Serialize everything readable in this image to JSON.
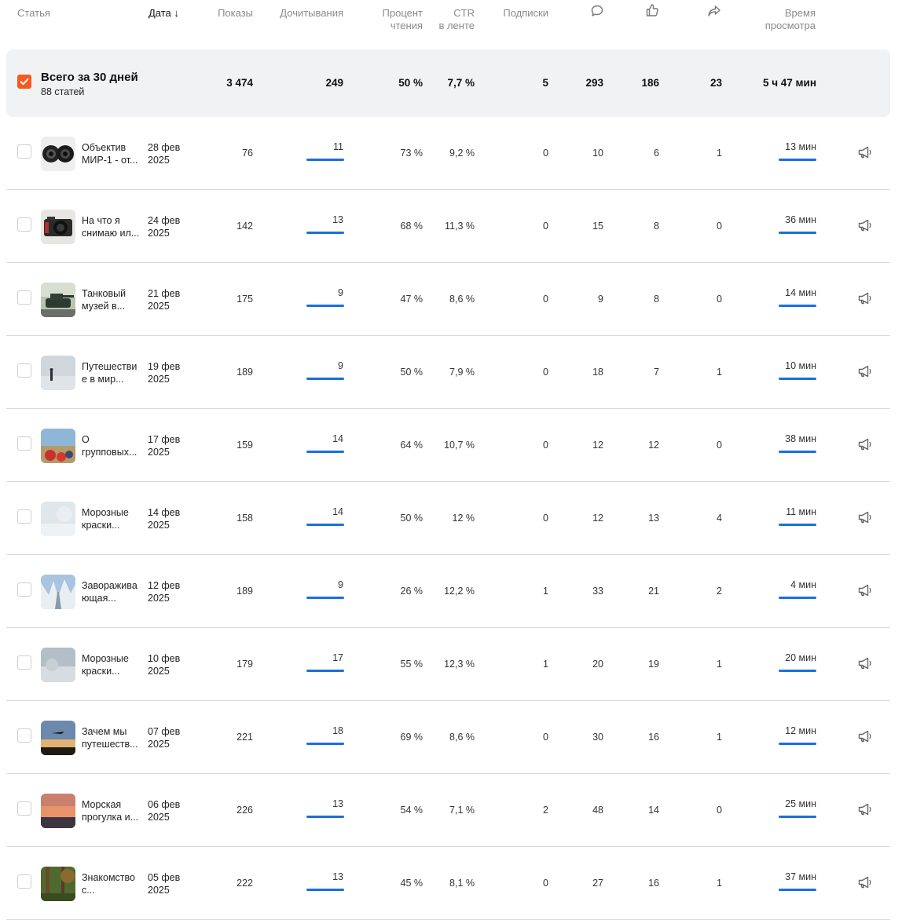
{
  "header": {
    "article": "Статья",
    "date": "Дата",
    "views": "Показы",
    "reads": "Дочитывания",
    "read_pct_1": "Процент",
    "read_pct_2": "чтения",
    "ctr_1": "CTR",
    "ctr_2": "в ленте",
    "subs": "Подписки",
    "watch_1": "Время",
    "watch_2": "просмотра",
    "comments_icon": "comment-icon",
    "likes_icon": "like-icon",
    "shares_icon": "share-icon"
  },
  "total": {
    "title": "Всего за 30 дней",
    "subtitle": "88 статей",
    "views": "3 474",
    "reads": "249",
    "read_pct": "50 %",
    "ctr": "7,7 %",
    "subs": "5",
    "comments": "293",
    "likes": "186",
    "shares": "23",
    "watch": "5 ч 47 мин",
    "accent": "#f55a1e"
  },
  "bar_color": "#1a6fdb",
  "rows": [
    {
      "name1": "Объектив",
      "name2": "МИР-1 - от...",
      "date1": "28 фев",
      "date2": "2025",
      "views": "76",
      "reads": "11",
      "read_pct": "73 %",
      "ctr": "9,2 %",
      "subs": "0",
      "comments": "10",
      "likes": "6",
      "shares": "1",
      "watch": "13 мин",
      "thumb": "lens"
    },
    {
      "name1": "На что я",
      "name2": "снимаю ил...",
      "date1": "24 фев",
      "date2": "2025",
      "views": "142",
      "reads": "13",
      "read_pct": "68 %",
      "ctr": "11,3 %",
      "subs": "0",
      "comments": "15",
      "likes": "8",
      "shares": "0",
      "watch": "36 мин",
      "thumb": "camera"
    },
    {
      "name1": "Танковый",
      "name2": "музей в...",
      "date1": "21 фев",
      "date2": "2025",
      "views": "175",
      "reads": "9",
      "read_pct": "47 %",
      "ctr": "8,6 %",
      "subs": "0",
      "comments": "9",
      "likes": "8",
      "shares": "0",
      "watch": "14 мин",
      "thumb": "tank"
    },
    {
      "name1": "Путешестви",
      "name2": "е в мир...",
      "date1": "19 фев",
      "date2": "2025",
      "views": "189",
      "reads": "9",
      "read_pct": "50 %",
      "ctr": "7,9 %",
      "subs": "0",
      "comments": "18",
      "likes": "7",
      "shares": "1",
      "watch": "10 мин",
      "thumb": "fog"
    },
    {
      "name1": "О",
      "name2": "групповых...",
      "date1": "17 фев",
      "date2": "2025",
      "views": "159",
      "reads": "14",
      "read_pct": "64 %",
      "ctr": "10,7 %",
      "subs": "0",
      "comments": "12",
      "likes": "12",
      "shares": "0",
      "watch": "38 мин",
      "thumb": "group"
    },
    {
      "name1": "Морозные",
      "name2": "краски...",
      "date1": "14 фев",
      "date2": "2025",
      "views": "158",
      "reads": "14",
      "read_pct": "50 %",
      "ctr": "12 %",
      "subs": "0",
      "comments": "12",
      "likes": "13",
      "shares": "4",
      "watch": "11 мин",
      "thumb": "frost"
    },
    {
      "name1": "Завораживa",
      "name2": "ющая...",
      "date1": "12 фев",
      "date2": "2025",
      "views": "189",
      "reads": "9",
      "read_pct": "26 %",
      "ctr": "12,2 %",
      "subs": "1",
      "comments": "33",
      "likes": "21",
      "shares": "2",
      "watch": "4 мин",
      "thumb": "winter"
    },
    {
      "name1": "Морозные",
      "name2": "краски...",
      "date1": "10 фев",
      "date2": "2025",
      "views": "179",
      "reads": "17",
      "read_pct": "55 %",
      "ctr": "12,3 %",
      "subs": "1",
      "comments": "20",
      "likes": "19",
      "shares": "1",
      "watch": "20 мин",
      "thumb": "frost2"
    },
    {
      "name1": "Зачем мы",
      "name2": "путешеств...",
      "date1": "07 фев",
      "date2": "2025",
      "views": "221",
      "reads": "18",
      "read_pct": "69 %",
      "ctr": "8,6 %",
      "subs": "0",
      "comments": "30",
      "likes": "16",
      "shares": "1",
      "watch": "12 мин",
      "thumb": "plane"
    },
    {
      "name1": "Морская",
      "name2": "прогулка и...",
      "date1": "06 фев",
      "date2": "2025",
      "views": "226",
      "reads": "13",
      "read_pct": "54 %",
      "ctr": "7,1 %",
      "subs": "2",
      "comments": "48",
      "likes": "14",
      "shares": "0",
      "watch": "25 мин",
      "thumb": "sunset"
    },
    {
      "name1": "Знакомство",
      "name2": "с...",
      "date1": "05 фев",
      "date2": "2025",
      "views": "222",
      "reads": "13",
      "read_pct": "45 %",
      "ctr": "8,1 %",
      "subs": "0",
      "comments": "27",
      "likes": "16",
      "shares": "1",
      "watch": "37 мин",
      "thumb": "forest"
    }
  ]
}
